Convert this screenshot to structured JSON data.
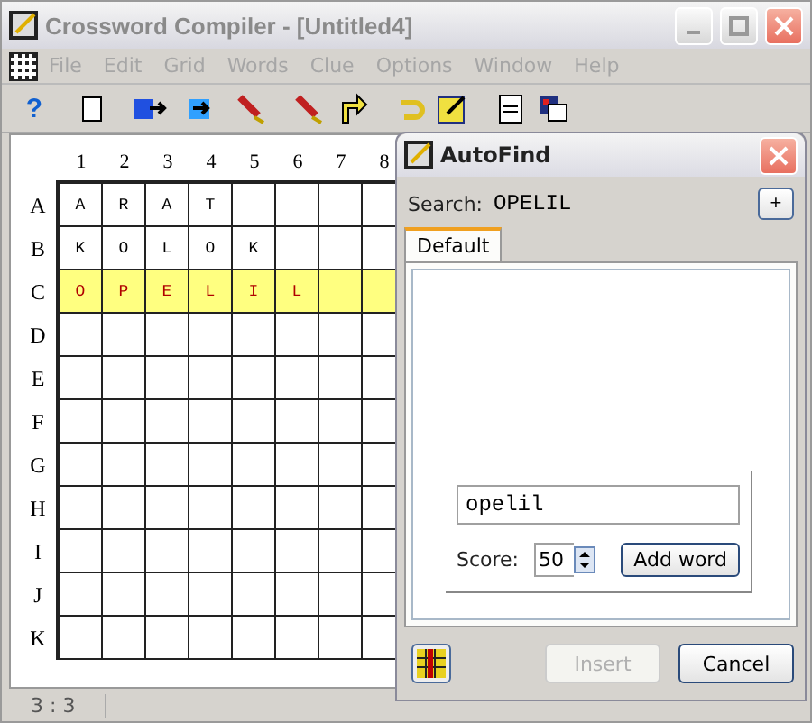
{
  "window": {
    "title": "Crossword Compiler - [Untitled4]"
  },
  "menu": [
    "File",
    "Edit",
    "Grid",
    "Words",
    "Clue",
    "Options",
    "Window",
    "Help"
  ],
  "grid": {
    "columns": [
      "1",
      "2",
      "3",
      "4",
      "5",
      "6",
      "7",
      "8"
    ],
    "rows": [
      {
        "label": "A",
        "highlighted": false,
        "cells": [
          {
            "letter": "A"
          },
          {
            "letter": "R"
          },
          {
            "letter": "A"
          },
          {
            "letter": "T"
          },
          {},
          {},
          {},
          {}
        ]
      },
      {
        "label": "B",
        "highlighted": false,
        "cells": [
          {
            "letter": "K"
          },
          {
            "letter": "O"
          },
          {
            "letter": "L"
          },
          {
            "letter": "O"
          },
          {
            "letter": "K"
          },
          {},
          {},
          {}
        ]
      },
      {
        "label": "C",
        "highlighted": true,
        "cells": [
          {
            "letter": "O"
          },
          {
            "letter": "P"
          },
          {
            "letter": "E"
          },
          {
            "letter": "L"
          },
          {
            "letter": "I"
          },
          {
            "letter": "L"
          },
          {},
          {}
        ]
      },
      {
        "label": "D",
        "highlighted": false,
        "cells": [
          {},
          {},
          {},
          {},
          {},
          {},
          {},
          {}
        ]
      },
      {
        "label": "E",
        "highlighted": false,
        "cells": [
          {},
          {},
          {},
          {},
          {},
          {},
          {},
          {}
        ]
      },
      {
        "label": "F",
        "highlighted": false,
        "cells": [
          {},
          {},
          {},
          {},
          {},
          {},
          {},
          {}
        ]
      },
      {
        "label": "G",
        "highlighted": false,
        "cells": [
          {},
          {},
          {},
          {},
          {},
          {},
          {},
          {}
        ]
      },
      {
        "label": "H",
        "highlighted": false,
        "cells": [
          {},
          {},
          {},
          {},
          {},
          {},
          {},
          {}
        ]
      },
      {
        "label": "I",
        "highlighted": false,
        "cells": [
          {},
          {},
          {},
          {},
          {},
          {},
          {},
          {}
        ]
      },
      {
        "label": "J",
        "highlighted": false,
        "cells": [
          {},
          {},
          {},
          {},
          {},
          {},
          {},
          {}
        ]
      },
      {
        "label": "K",
        "highlighted": false,
        "cells": [
          {},
          {},
          {},
          {},
          {},
          {},
          {},
          {}
        ]
      }
    ]
  },
  "help_button": "?",
  "status_bar": "3 : 3",
  "dialog": {
    "title": "AutoFind",
    "search_label": "Search:",
    "search_value": "OPELIL",
    "plus_button": "+",
    "tabs": [
      {
        "label": "Default",
        "selected": true
      }
    ],
    "word_field": "opelil",
    "score_label": "Score:",
    "score": "50",
    "add_button": "Add word",
    "insert_button": {
      "label": "Insert",
      "disabled": true
    },
    "cancel_button": "Cancel"
  }
}
